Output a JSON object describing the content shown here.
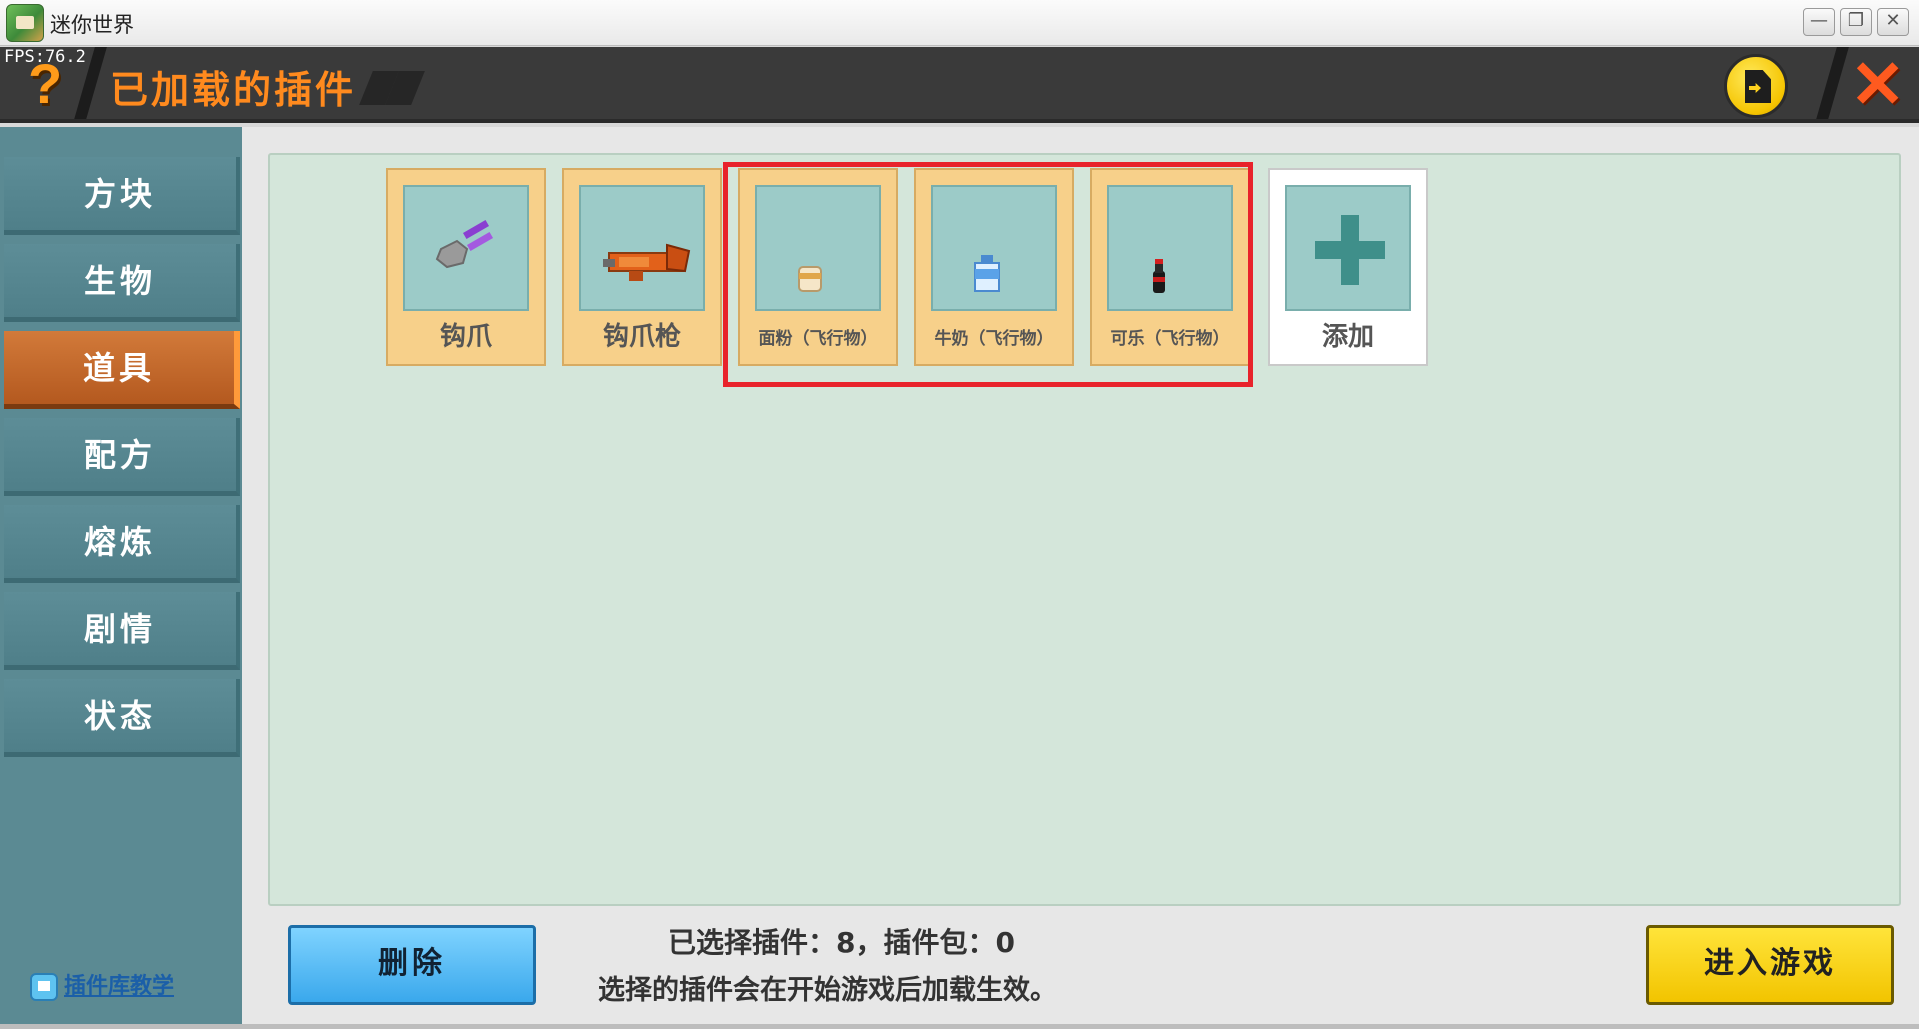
{
  "window": {
    "title": "迷你世界",
    "minimize": "—",
    "maximize": "❐",
    "close": "✕"
  },
  "fps": "FPS:76.2",
  "header": {
    "help": "?",
    "title": "已加载的插件",
    "close": "✕"
  },
  "sidebar": {
    "items": [
      {
        "label": "方块",
        "active": false
      },
      {
        "label": "生物",
        "active": false
      },
      {
        "label": "道具",
        "active": true
      },
      {
        "label": "配方",
        "active": false
      },
      {
        "label": "熔炼",
        "active": false
      },
      {
        "label": "剧情",
        "active": false
      },
      {
        "label": "状态",
        "active": false
      }
    ],
    "tutorial": "插件库教学"
  },
  "plugins": [
    {
      "label": "钩爪",
      "icon": "claw-icon"
    },
    {
      "label": "钩爪枪",
      "icon": "claw-gun-icon"
    },
    {
      "label": "面粉（飞行物）",
      "icon": "flour-icon"
    },
    {
      "label": "牛奶（飞行物）",
      "icon": "milk-icon"
    },
    {
      "label": "可乐（飞行物）",
      "icon": "cola-icon"
    }
  ],
  "add": {
    "label": "添加"
  },
  "footer": {
    "delete": "删除",
    "summary": "已选择插件：8，插件包：0",
    "hint": "选择的插件会在开始游戏后加载生效。",
    "enter": "进入游戏"
  },
  "colors": {
    "accent": "#ff8a1e",
    "highlight": "#e8232b",
    "panel": "#d4e6da",
    "sidebar": "#5b8a93"
  }
}
